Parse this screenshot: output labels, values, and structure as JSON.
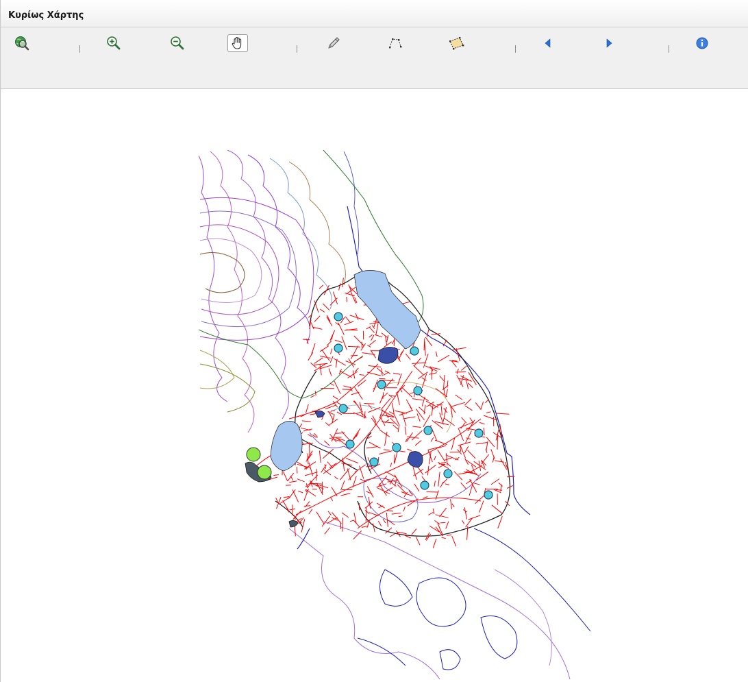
{
  "window": {
    "title": "Κυρίως Χάρτης"
  },
  "toolbar": {
    "tools": [
      {
        "id": "full-extent",
        "icon": "globe-magnifier-icon"
      },
      {
        "id": "zoom-in",
        "icon": "zoom-in-icon"
      },
      {
        "id": "zoom-out",
        "icon": "zoom-out-icon"
      },
      {
        "id": "pan",
        "icon": "hand-icon",
        "active": true
      },
      {
        "id": "draw-line",
        "icon": "pencil-icon"
      },
      {
        "id": "measure-distance",
        "icon": "polyline-icon"
      },
      {
        "id": "measure-area",
        "icon": "polygon-icon"
      },
      {
        "id": "previous-extent",
        "icon": "arrow-left-icon"
      },
      {
        "id": "next-extent",
        "icon": "arrow-right-icon"
      },
      {
        "id": "identify",
        "icon": "info-icon"
      }
    ]
  },
  "map": {
    "layers": [
      "contours",
      "coastline",
      "streams",
      "watershed-boundary",
      "lakes",
      "stations",
      "points-of-interest"
    ],
    "colors": {
      "stream": "#ff0000",
      "station": "#52cbe0",
      "lake": "#a6c8f0",
      "reservoir": "#3a4fa8",
      "coastline": "#1f1fbf",
      "highlight": "#8ee84a",
      "boundary": "#222222",
      "road": "#2f7a2f"
    }
  }
}
